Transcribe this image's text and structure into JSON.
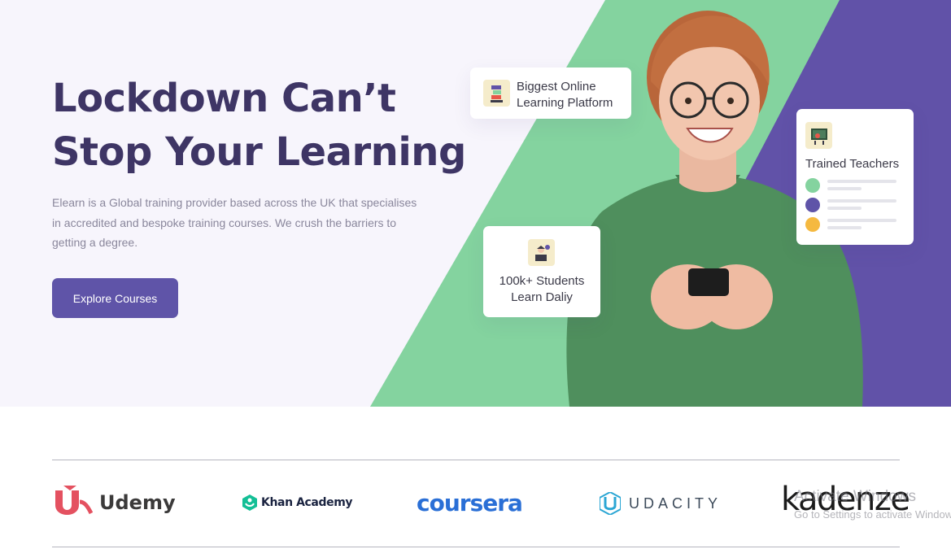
{
  "hero": {
    "headline_line1": "Lockdown Can’t",
    "headline_line2": "Stop Your Learning",
    "description": "Elearn is a Global training provider based across the UK that specialises in accredited and bespoke training courses. We crush the barriers to getting a degree.",
    "cta_label": "Explore Courses",
    "colors": {
      "background": "#f7f5fc",
      "green": "#84d39f",
      "purple": "#6152a8",
      "headline": "#3e3565",
      "button": "#5f54a8"
    }
  },
  "cards": {
    "platform": {
      "icon": "books-icon",
      "line1": "Biggest Online",
      "line2": "Learning Platform"
    },
    "students": {
      "icon": "student-laptop-icon",
      "line1": "100k+ Students",
      "line2": "Learn Daliy"
    },
    "teachers": {
      "icon": "teacher-board-icon",
      "title": "Trained Teachers",
      "dot_colors": [
        "#84d39f",
        "#5f54a8",
        "#f5b940"
      ]
    }
  },
  "partners": [
    {
      "name": "Udemy",
      "icon": "udemy-logo-icon"
    },
    {
      "name": "Khan Academy",
      "icon": "khan-academy-logo-icon"
    },
    {
      "name": "coursera",
      "icon": "coursera-logo-icon"
    },
    {
      "name": "UDACITY",
      "icon": "udacity-logo-icon"
    },
    {
      "name": "kadenze",
      "icon": "kadenze-logo-icon"
    }
  ],
  "watermark": {
    "line1": "Activate Windows",
    "line2": "Go to Settings to activate Windows."
  }
}
